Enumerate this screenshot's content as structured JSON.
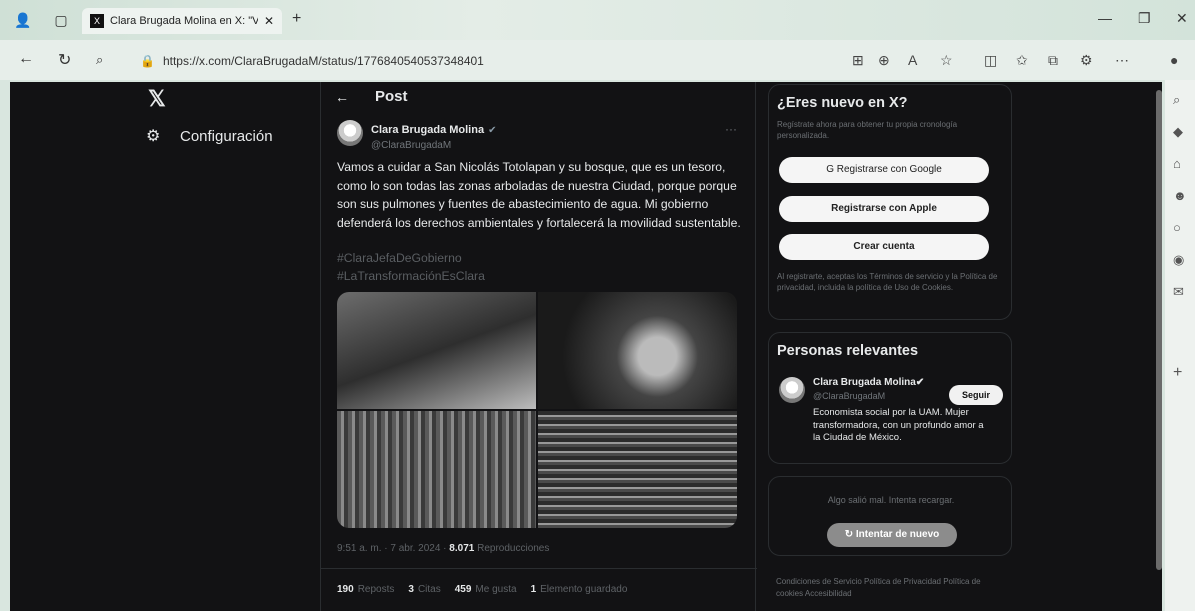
{
  "browser": {
    "tab_title": "Clara Brugada Molina en X: \"Vam",
    "tab_favicon": "X",
    "url": "https://x.com/ClaraBrugadaM/status/1776840540537348401"
  },
  "sidebar": {
    "logo": "𝕏",
    "settings_label": "Configuración"
  },
  "post": {
    "header_title": "Post",
    "author_name": "Clara Brugada Molina",
    "author_handle": "@ClaraBrugadaM",
    "text": "Vamos a cuidar a San Nicolás Totolapan y su bosque, que es un tesoro, como lo son todas las zonas arboladas de nuestra Ciudad, porque porque son sus pulmones y fuentes de abastecimiento de agua. Mi gobierno defenderá los derechos ambientales y fortalecerá la movilidad sustentable.",
    "hashtag1": "#ClaraJefaDeGobierno",
    "hashtag2": "#LaTransformaciónEsClara",
    "time": "9:51 a. m. · 7 abr. 2024 · ",
    "views": "8.071",
    "views_label": " Reproducciones",
    "stats": {
      "reposts": "190",
      "reposts_label": "Reposts",
      "quotes": "3",
      "quotes_label": "Citas",
      "likes": "459",
      "likes_label": "Me gusta",
      "bookmarks": "1",
      "bookmarks_label": "Elemento guardado"
    }
  },
  "signup": {
    "title": "¿Eres nuevo en X?",
    "subtitle": "Regístrate ahora para obtener tu propia cronología personalizada.",
    "google": "Registrarse con Google",
    "apple": "Registrarse con Apple",
    "create": "Crear cuenta",
    "legal": "Al registrarte, aceptas los Términos de servicio y la Política de privacidad, incluida la política de Uso de Cookies."
  },
  "relevant": {
    "title": "Personas relevantes",
    "name": "Clara Brugada Molina",
    "handle": "@ClaraBrugadaM",
    "follow": "Seguir",
    "bio": "Economista social por la UAM. Mujer transformadora, con un profundo amor a la Ciudad de México."
  },
  "error_box": {
    "message": "Algo salió mal. Intenta recargar.",
    "retry": "Intentar de nuevo"
  },
  "footer": {
    "links": "Condiciones de Servicio   Política de Privacidad   Política de cookies   Accesibilidad"
  }
}
